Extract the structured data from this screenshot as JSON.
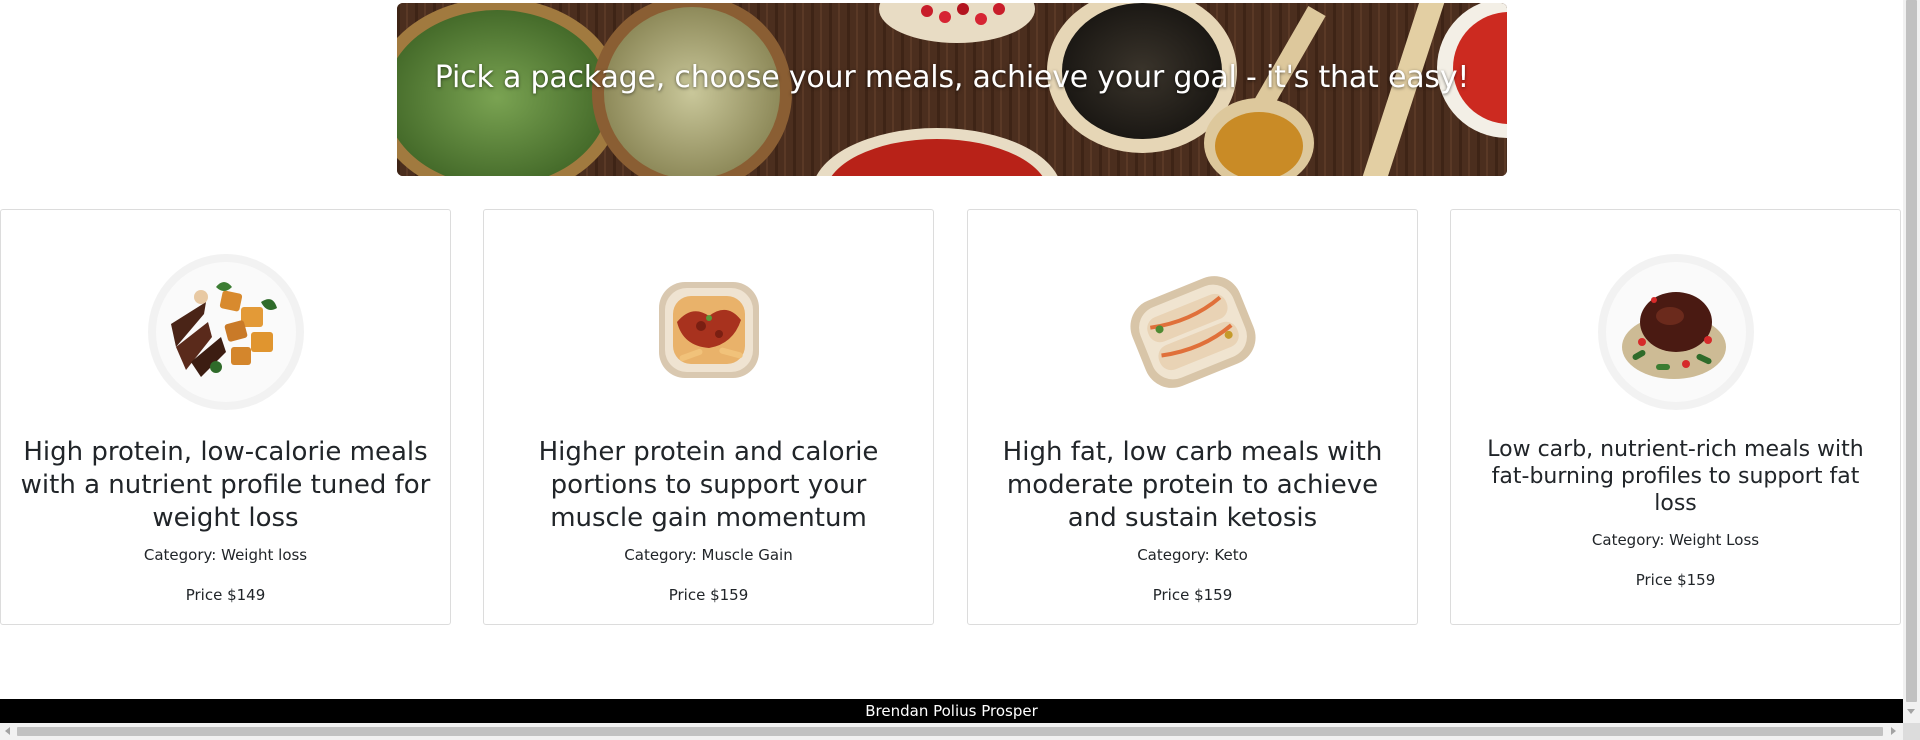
{
  "hero": {
    "tagline": "Pick a package, choose your meals, achieve your goal - it's that easy!"
  },
  "packages": [
    {
      "title": "High protein, low-calorie meals with a nutrient profile tuned for weight loss",
      "category": "Category: Weight loss",
      "price": "Price $149",
      "image_icon": "stir-fry-plate-icon"
    },
    {
      "title": "Higher protein and calorie portions to support your muscle gain momentum",
      "category": "Category: Muscle Gain",
      "price": "Price $159",
      "image_icon": "pasta-container-icon"
    },
    {
      "title": "High fat, low carb meals with moderate protein to achieve and sustain ketosis",
      "category": "Category: Keto",
      "price": "Price $159",
      "image_icon": "wrap-container-icon"
    },
    {
      "title": "Low carb, nutrient-rich meals with fat-burning profiles to support fat loss",
      "category": "Category: Weight Loss",
      "price": "Price $159",
      "image_icon": "glazed-chicken-plate-icon"
    }
  ],
  "footer": {
    "text": "Brendan Polius Prosper"
  },
  "colors": {
    "footer_bg": "#000000",
    "text": "#212529",
    "card_border": "#dcdcdc"
  }
}
